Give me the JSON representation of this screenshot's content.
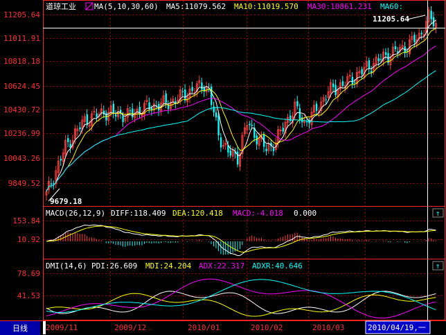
{
  "colors": {
    "up": "#ff3c3c",
    "down": "#00ffff",
    "ma5": "#ffffff",
    "ma10": "#ffff00",
    "ma30": "#ff00ff",
    "ma60": "#00ffff",
    "frame": "#ff2020",
    "grid": "#a00000",
    "background": "#000000"
  },
  "price_panel": {
    "title": "道琼工业",
    "legend_icon": "ma-legend-icon",
    "ma_params": "MA(5,10,30,60)",
    "ma5": "MA5:11079.562",
    "ma10": "MA10:11019.570",
    "ma30": "MA30:10861.231",
    "ma60": "MA60:",
    "y_ticks": [
      "11205.64",
      "11011.91",
      "10818.18",
      "10624.45",
      "10430.72",
      "10236.99",
      "10043.26",
      "9849.52"
    ],
    "max_label": "11205.64",
    "min_label": "9679.18"
  },
  "macd_panel": {
    "params": "MACD(26,12,9)",
    "diff": "DIFF:118.409",
    "dea": "DEA:120.418",
    "macd": "MACD:-4.018",
    "extra": "0.000",
    "y_ticks": [
      "153.84",
      "10.92"
    ],
    "expand_icon": "↑"
  },
  "dmi_panel": {
    "params": "DMI(14,6)",
    "pdi": "PDI:26.609",
    "mdi": "MDI:24.204",
    "adx": "ADX:22.317",
    "adxr": "ADXR:40.646",
    "y_ticks": [
      "78.69",
      "41.53"
    ],
    "expand_icon": "↑"
  },
  "footer": {
    "period_button": "日线",
    "dates": [
      "2009/11",
      "2009/12",
      "2010/01",
      "2010/02",
      "2010/03"
    ],
    "cursor_date": "2010/04/19,一"
  },
  "chart_data": {
    "type": "candlestick",
    "title": "道琼工业",
    "x": [
      "2009/11",
      "2009/12",
      "2010/01",
      "2010/02",
      "2010/03",
      "2010/04/19"
    ],
    "ylim": [
      9679.18,
      11205.64
    ],
    "series": [
      {
        "name": "MA5",
        "values": [
          10250,
          10380,
          10560,
          10150,
          10620,
          11080
        ]
      },
      {
        "name": "MA10",
        "values": [
          10150,
          10360,
          10520,
          10260,
          10560,
          11020
        ]
      },
      {
        "name": "MA30",
        "values": [
          9980,
          10260,
          10380,
          10330,
          10420,
          10861
        ]
      },
      {
        "name": "MA60",
        "values": [
          9720,
          10060,
          10270,
          10380,
          10380,
          10650
        ]
      }
    ]
  }
}
